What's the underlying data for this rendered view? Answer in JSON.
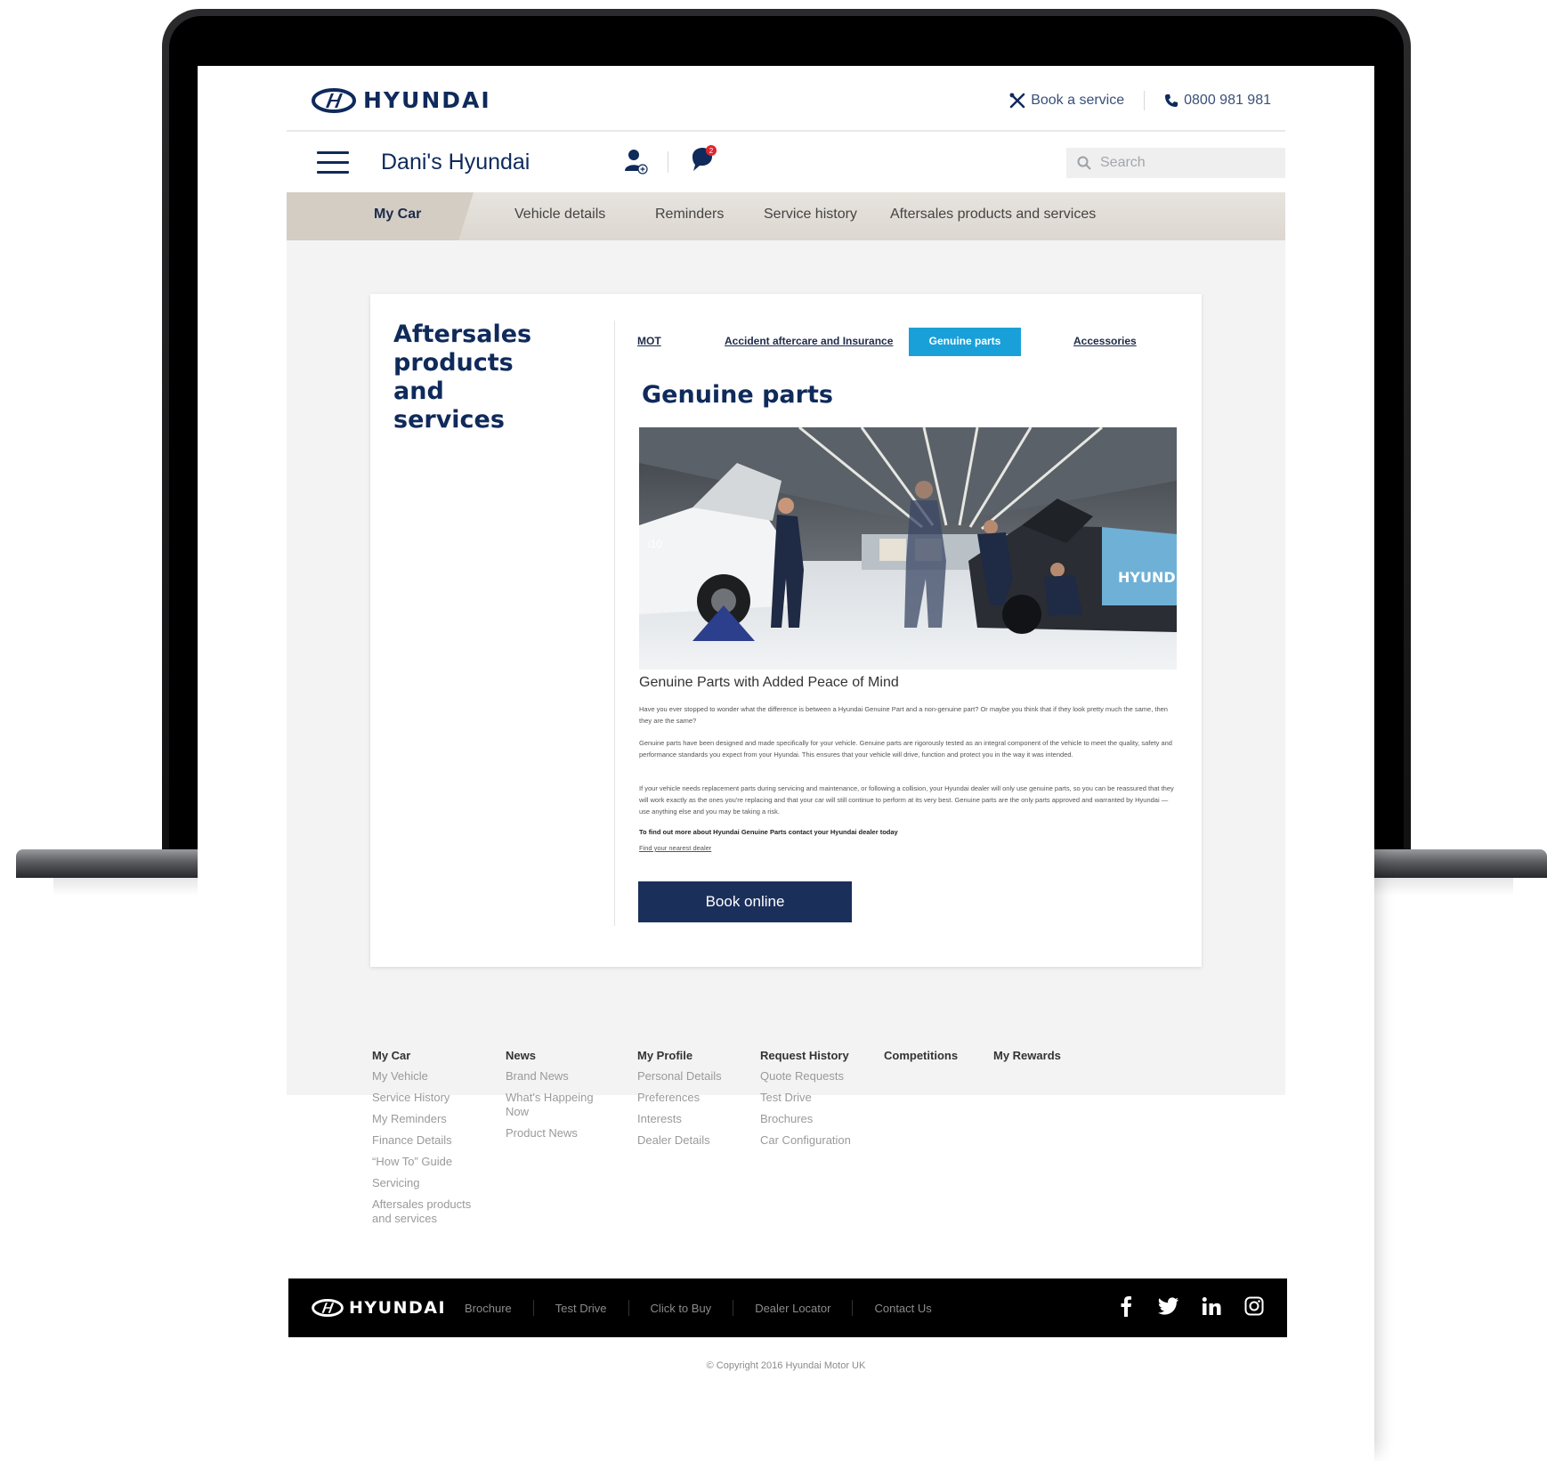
{
  "header": {
    "brand": "HYUNDAI",
    "book_service": "Book a service",
    "phone": "0800 981 981"
  },
  "subbar": {
    "title": "Dani's Hyundai",
    "chat_badge": "2",
    "search_placeholder": "Search"
  },
  "nav": {
    "items": [
      {
        "label": "My Car",
        "active": true
      },
      {
        "label": "Vehicle details"
      },
      {
        "label": "Reminders"
      },
      {
        "label": "Service history"
      },
      {
        "label": "Aftersales products and services"
      }
    ]
  },
  "sidebar": {
    "title": "Aftersales products and services"
  },
  "tabs": [
    {
      "label": "MOT"
    },
    {
      "label": "Accident aftercare and Insurance"
    },
    {
      "label": "Genuine parts",
      "active": true
    },
    {
      "label": "Accessories"
    }
  ],
  "content": {
    "title": "Genuine parts",
    "hero_car_label": "i10",
    "hero_car_brand": "HYUND",
    "subheading": "Genuine Parts with Added Peace of Mind",
    "para1": "Have you ever stopped to wonder what the difference is between a Hyundai Genuine Part and a non-genuine part? Or maybe you think that if they look pretty much the same, then they are the same?",
    "para2": "Genuine parts have been designed and made specifically for your vehicle. Genuine parts are rigorously tested as an integral component of the vehicle to meet the quality, safety and performance standards you expect from your Hyundai. This ensures that your vehicle will drive, function and protect you in the way it was intended.",
    "para3": "If your vehicle needs replacement parts during servicing and maintenance, or following a collision, your Hyundai dealer will only use genuine parts, so you can be reassured that they will work exactly as the ones you're replacing and that your car will still continue to perform at its very best. Genuine parts are the only parts approved and warranted by Hyundai — use anything else and you may be taking a risk.",
    "cta": "To find out more about Hyundai Genuine Parts contact your Hyundai dealer today",
    "dealer_link": "Find your nearest dealer",
    "book_button": "Book online"
  },
  "footer_cols": [
    {
      "head": "My Car",
      "items": [
        "My Vehicle",
        "Service History",
        "My Reminders",
        "Finance Details",
        "“How To” Guide",
        "Servicing",
        "Aftersales products and services"
      ]
    },
    {
      "head": "News",
      "items": [
        "Brand News",
        "What's Happeing Now",
        "Product News"
      ]
    },
    {
      "head": "My Profile",
      "items": [
        "Personal Details",
        "Preferences",
        "Interests",
        "Dealer Details"
      ]
    },
    {
      "head": "Request History",
      "items": [
        "Quote Requests",
        "Test Drive",
        "Brochures",
        "Car Configuration"
      ]
    },
    {
      "head": "Competitions",
      "items": []
    },
    {
      "head": "My Rewards",
      "items": []
    }
  ],
  "footer_bar": {
    "brand": "HYUNDAI",
    "links": [
      "Brochure",
      "Test Drive",
      "Click to Buy",
      "Dealer Locator",
      "Contact Us"
    ],
    "social": [
      "facebook-icon",
      "twitter-icon",
      "linkedin-icon",
      "instagram-icon"
    ]
  },
  "copyright": "© Copyright 2016 Hyundai Motor UK",
  "colors": {
    "brand_navy": "#0f2a5b",
    "accent_blue": "#1aa0d8",
    "button_navy": "#1b2f5b",
    "badge_red": "#e0242d"
  }
}
